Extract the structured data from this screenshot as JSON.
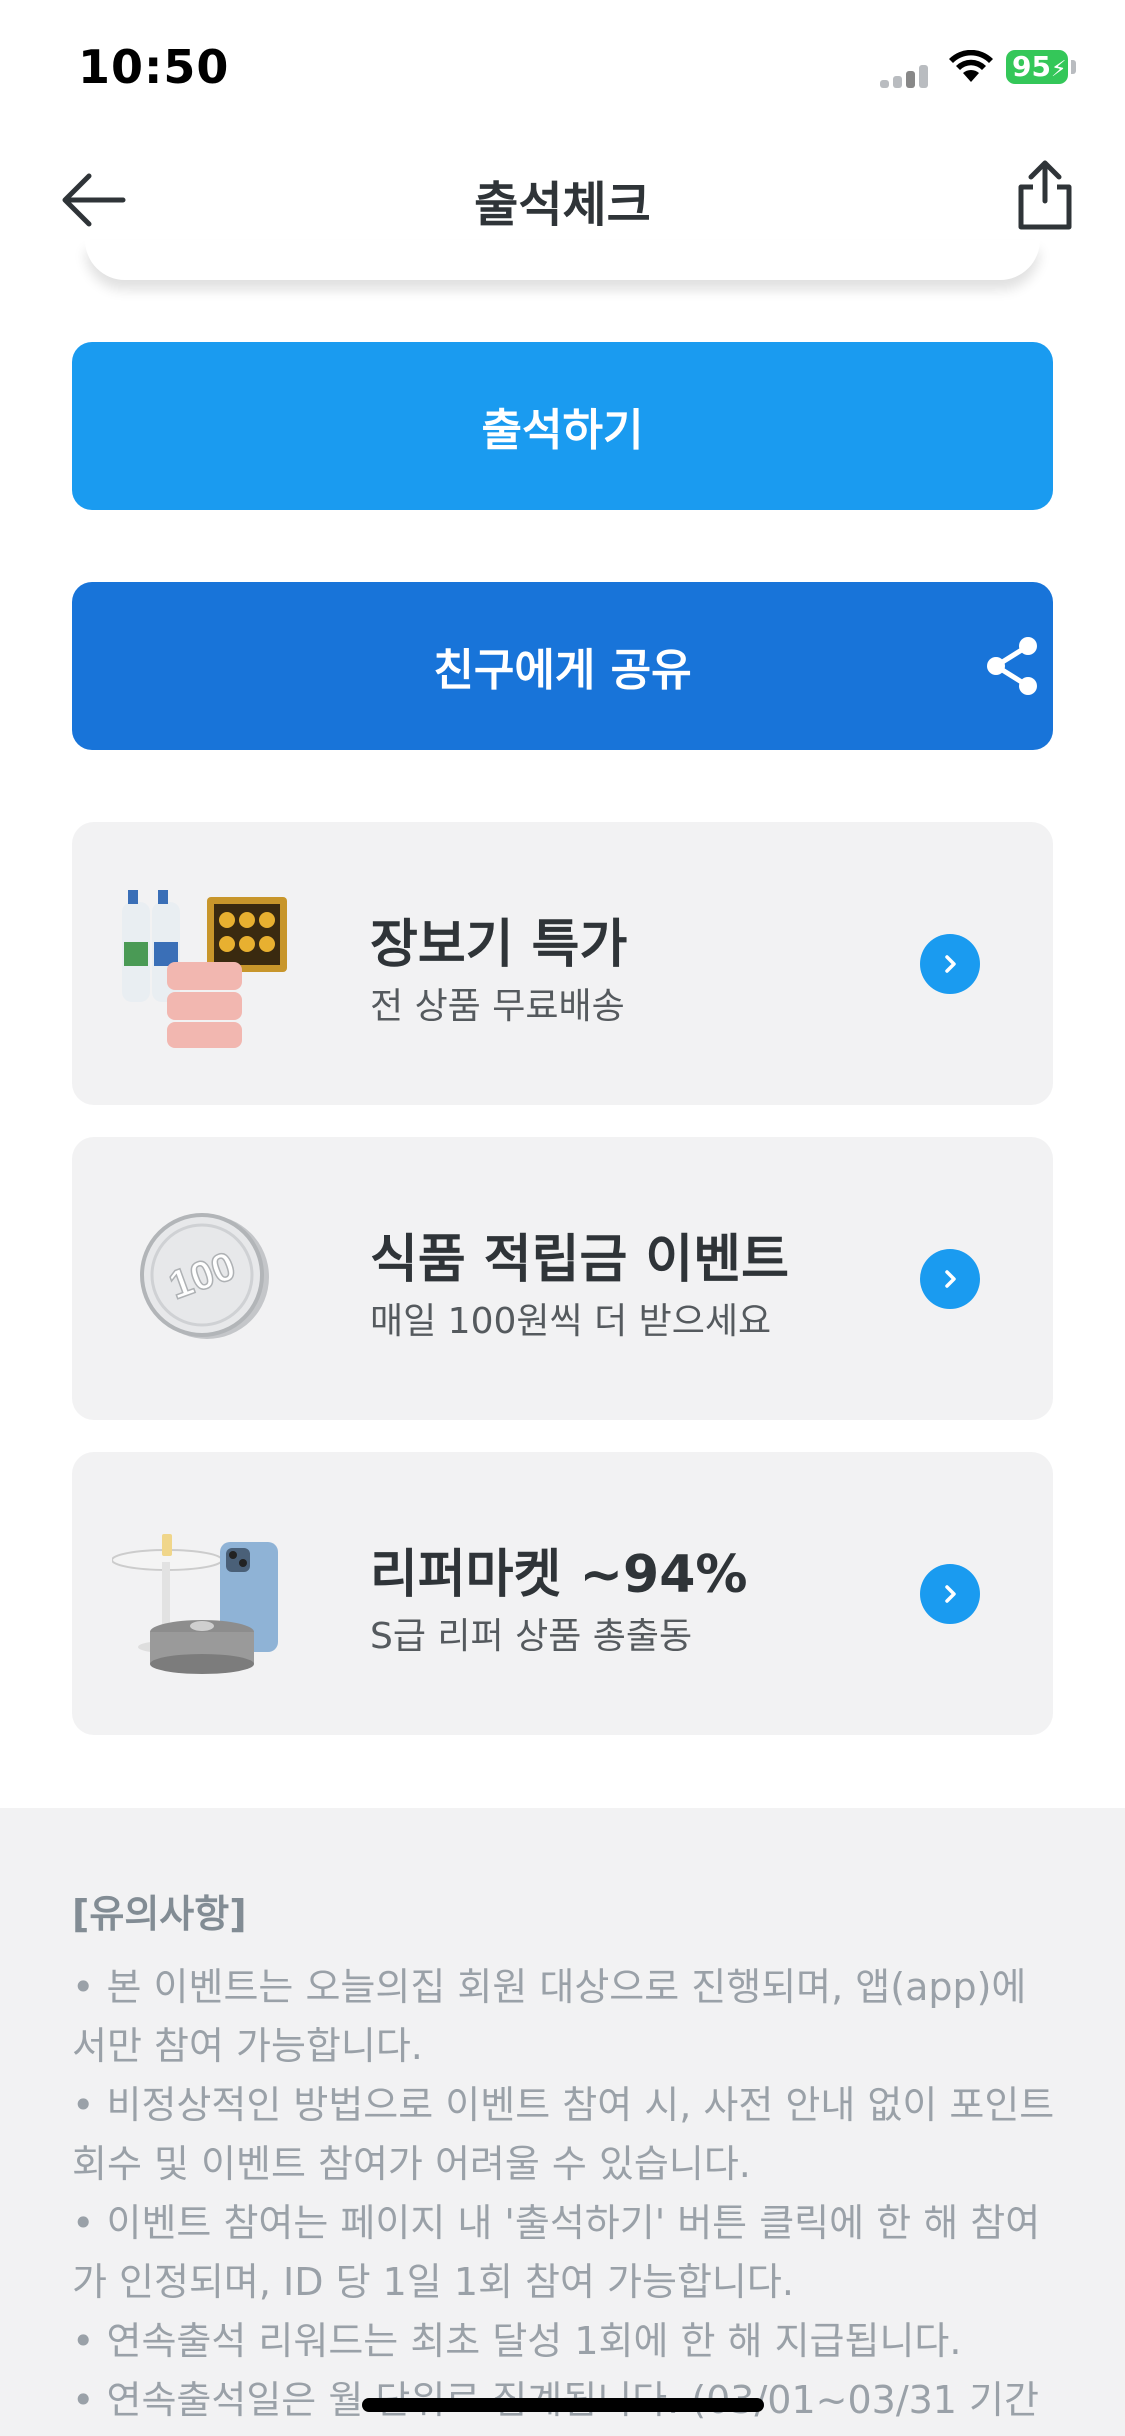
{
  "status": {
    "time": "10:50",
    "battery": "95"
  },
  "header": {
    "title": "출석체크"
  },
  "buttons": {
    "attend": "출석하기",
    "share": "친구에게 공유"
  },
  "promos": [
    {
      "title": "장보기 특가",
      "subtitle": "전 상품 무료배송",
      "icon": "groceries-image"
    },
    {
      "title": "식품 적립금 이벤트",
      "subtitle": "매일 100원씩 더 받으세요",
      "icon": "coin-100-image"
    },
    {
      "title": "리퍼마켓 ~94%",
      "subtitle": "S급 리퍼 상품 총출동",
      "icon": "refurb-products-image"
    }
  ],
  "notice": {
    "title": "[유의사항]",
    "lines": [
      "• 본 이벤트는 오늘의집 회원 대상으로 진행되며, 앱(app)에서만 참여 가능합니다.",
      "• 비정상적인 방법으로 이벤트 참여 시, 사전 안내 없이 포인트 회수 및 이벤트 참여가 어려울 수 있습니다.",
      "• 이벤트 참여는 페이지 내 '출석하기' 버튼 클릭에 한 해 참여가 인정되며, ID 당 1일 1회 참여 가능합니다.",
      "• 연속출석 리워드는 최초 달성 1회에 한 해 지급됩니다.",
      "• 연속출석일은 월 단위로 집계됩니다. (03/01~03/31 기간"
    ]
  },
  "colors": {
    "accent": "#1a9bf0",
    "share": "#1874d9",
    "card": "#f2f2f3"
  }
}
